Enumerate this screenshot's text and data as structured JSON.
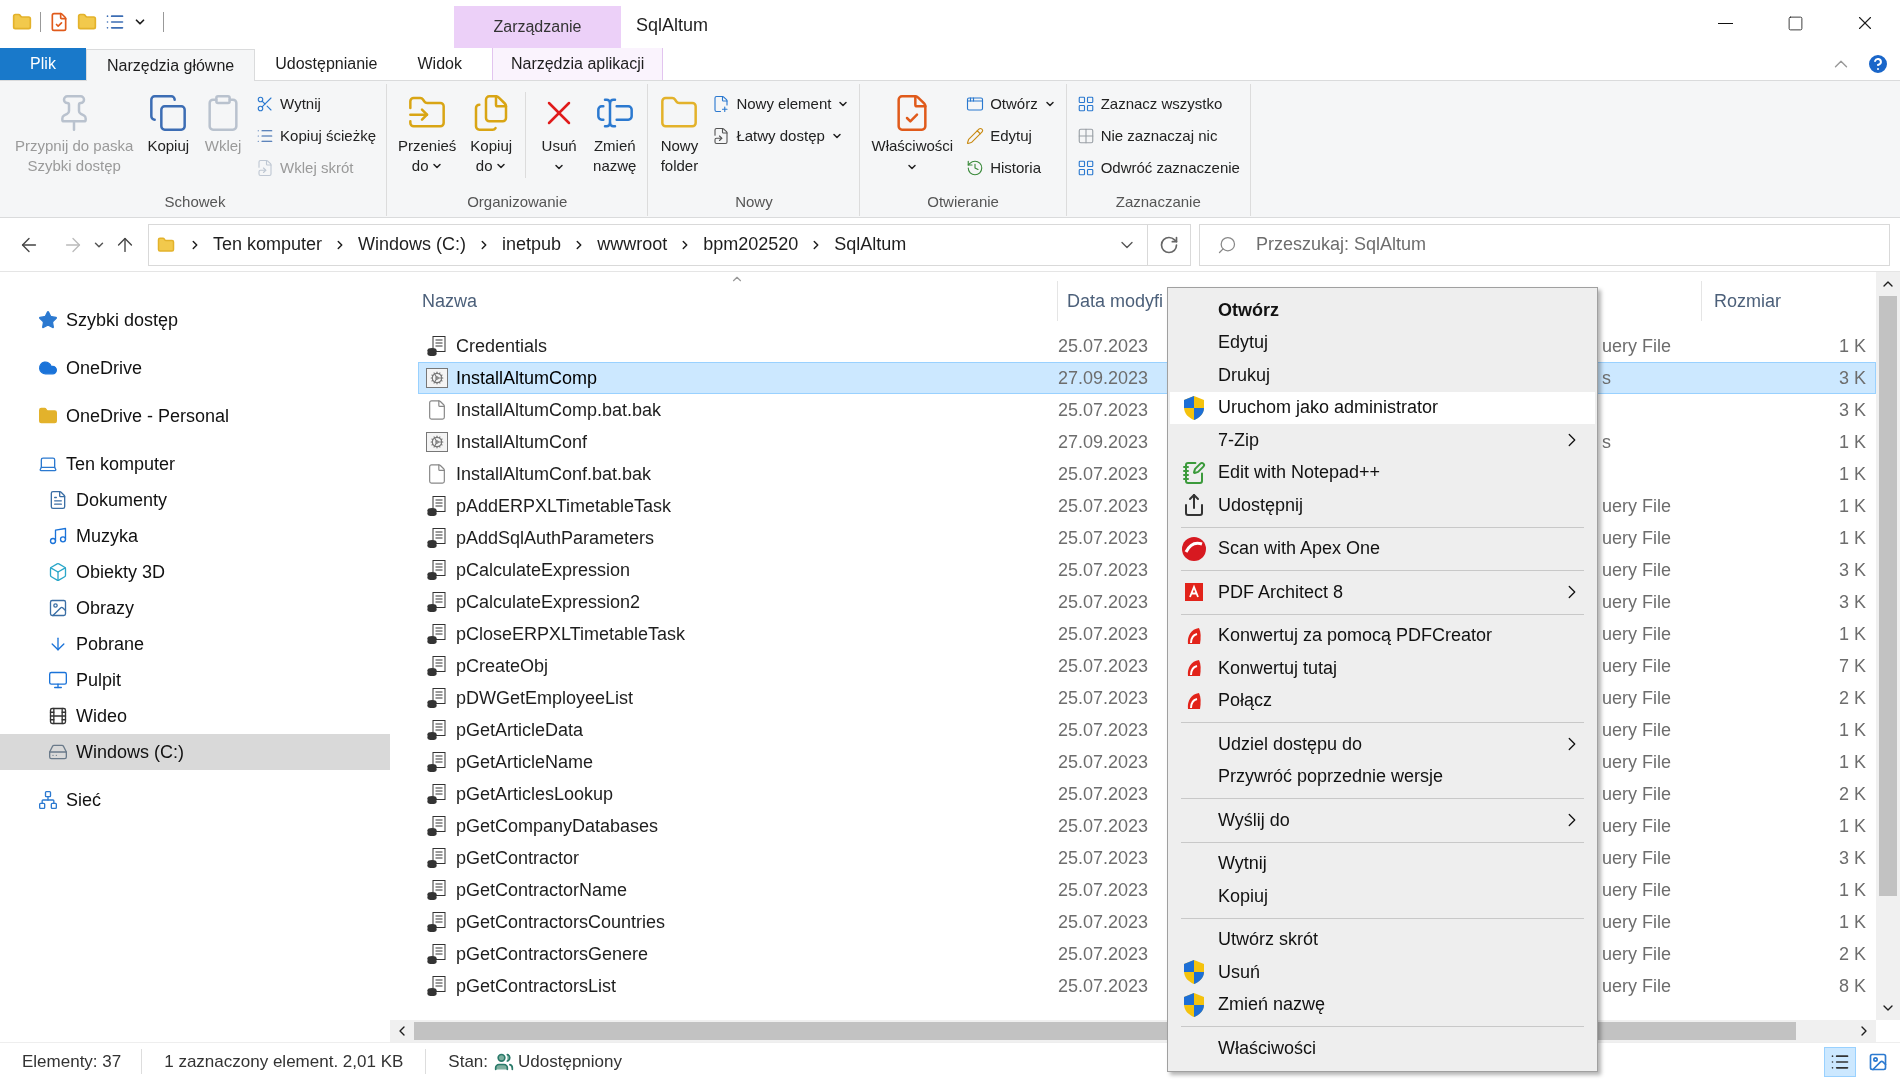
{
  "window": {
    "title": "SqlAltum",
    "contextual_group": "Zarządzanie"
  },
  "ribbon_tabs": [
    {
      "label": "Plik",
      "kind": "file",
      "selected": false
    },
    {
      "label": "Narzędzia główne",
      "kind": "tab",
      "selected": true
    },
    {
      "label": "Udostępnianie",
      "kind": "tab",
      "selected": false
    },
    {
      "label": "Widok",
      "kind": "tab",
      "selected": false
    },
    {
      "label": "Narzędzia aplikacji",
      "kind": "contextual",
      "selected": false
    }
  ],
  "ribbon_groups": [
    {
      "label": "Schowek",
      "items": [
        {
          "kind": "large",
          "lines": [
            "Przypnij do paska",
            "Szybki dostęp"
          ],
          "disabled": true,
          "dropdown": false
        },
        {
          "kind": "large",
          "lines": [
            "Kopiuj"
          ],
          "disabled": false,
          "dropdown": false
        },
        {
          "kind": "large",
          "lines": [
            "Wklej"
          ],
          "disabled": true,
          "dropdown": false
        },
        {
          "kind": "small",
          "lines": [
            "Wytnij"
          ],
          "disabled": false,
          "dropdown": false
        },
        {
          "kind": "small",
          "lines": [
            "Kopiuj ścieżkę"
          ],
          "disabled": false,
          "dropdown": false
        },
        {
          "kind": "small",
          "lines": [
            "Wklej skrót"
          ],
          "disabled": true,
          "dropdown": false
        }
      ]
    },
    {
      "label": "Organizowanie",
      "items": [
        {
          "kind": "large",
          "lines": [
            "Przenieś",
            "do"
          ],
          "disabled": false,
          "dropdown": true
        },
        {
          "kind": "large",
          "lines": [
            "Kopiuj",
            "do"
          ],
          "disabled": false,
          "dropdown": true
        },
        {
          "kind": "divider"
        },
        {
          "kind": "large",
          "lines": [
            "Usuń"
          ],
          "disabled": false,
          "dropdown": true
        },
        {
          "kind": "large",
          "lines": [
            "Zmień",
            "nazwę"
          ],
          "disabled": false,
          "dropdown": false
        }
      ]
    },
    {
      "label": "Nowy",
      "items": [
        {
          "kind": "large",
          "lines": [
            "Nowy",
            "folder"
          ],
          "disabled": false,
          "dropdown": false
        },
        {
          "kind": "small",
          "lines": [
            "Nowy element"
          ],
          "disabled": false,
          "dropdown": true
        },
        {
          "kind": "small",
          "lines": [
            "Łatwy dostęp"
          ],
          "disabled": false,
          "dropdown": true
        }
      ]
    },
    {
      "label": "Otwieranie",
      "items": [
        {
          "kind": "large",
          "lines": [
            "Właściwości"
          ],
          "disabled": false,
          "dropdown": true
        },
        {
          "kind": "small",
          "lines": [
            "Otwórz"
          ],
          "disabled": false,
          "dropdown": true
        },
        {
          "kind": "small",
          "lines": [
            "Edytuj"
          ],
          "disabled": false,
          "dropdown": false
        },
        {
          "kind": "small",
          "lines": [
            "Historia"
          ],
          "disabled": false,
          "dropdown": false
        }
      ]
    },
    {
      "label": "Zaznaczanie",
      "items": [
        {
          "kind": "small",
          "lines": [
            "Zaznacz wszystko"
          ],
          "disabled": false,
          "dropdown": false
        },
        {
          "kind": "small",
          "lines": [
            "Nie zaznaczaj nic"
          ],
          "disabled": false,
          "dropdown": false
        },
        {
          "kind": "small",
          "lines": [
            "Odwróć zaznaczenie"
          ],
          "disabled": false,
          "dropdown": false
        }
      ]
    }
  ],
  "address_bar": {
    "crumbs": [
      "Ten komputer",
      "Windows (C:)",
      "inetpub",
      "wwwroot",
      "bpm202520",
      "SqlAltum"
    ]
  },
  "search": {
    "placeholder": "Przeszukaj: SqlAltum"
  },
  "nav_pane": [
    {
      "label": "Szybki dostęp",
      "selected": false
    },
    {
      "label": "OneDrive",
      "selected": false
    },
    {
      "label": "OneDrive - Personal",
      "selected": false
    },
    {
      "label": "Ten komputer",
      "selected": false,
      "children": [
        {
          "label": "Dokumenty",
          "selected": false
        },
        {
          "label": "Muzyka",
          "selected": false
        },
        {
          "label": "Obiekty 3D",
          "selected": false
        },
        {
          "label": "Obrazy",
          "selected": false
        },
        {
          "label": "Pobrane",
          "selected": false
        },
        {
          "label": "Pulpit",
          "selected": false
        },
        {
          "label": "Wideo",
          "selected": false
        },
        {
          "label": "Windows (C:)",
          "selected": true
        }
      ]
    },
    {
      "label": "Sieć",
      "selected": false
    }
  ],
  "file_list": {
    "columns": [
      "Nazwa",
      "Data modyfi",
      "Rozmiar"
    ],
    "rows": [
      {
        "name": "Credentials",
        "kind": "sql",
        "date": "25.07.2023",
        "type": "uery File",
        "size": "1 K",
        "selected": false
      },
      {
        "name": "InstallAltumComp",
        "kind": "batch",
        "date": "27.09.2023",
        "type": "s",
        "size": "3 K",
        "selected": true
      },
      {
        "name": "InstallAltumComp.bat.bak",
        "kind": "bak",
        "date": "25.07.2023",
        "size": "3 K",
        "selected": false
      },
      {
        "name": "InstallAltumConf",
        "kind": "batch",
        "date": "27.09.2023",
        "type": "s",
        "size": "1 K",
        "selected": false
      },
      {
        "name": "InstallAltumConf.bat.bak",
        "kind": "bak",
        "date": "25.07.2023",
        "size": "1 K",
        "selected": false
      },
      {
        "name": "pAddERPXLTimetableTask",
        "kind": "sql",
        "date": "25.07.2023",
        "type": "uery File",
        "size": "1 K",
        "selected": false
      },
      {
        "name": "pAddSqlAuthParameters",
        "kind": "sql",
        "date": "25.07.2023",
        "type": "uery File",
        "size": "1 K",
        "selected": false
      },
      {
        "name": "pCalculateExpression",
        "kind": "sql",
        "date": "25.07.2023",
        "type": "uery File",
        "size": "3 K",
        "selected": false
      },
      {
        "name": "pCalculateExpression2",
        "kind": "sql",
        "date": "25.07.2023",
        "type": "uery File",
        "size": "3 K",
        "selected": false
      },
      {
        "name": "pCloseERPXLTimetableTask",
        "kind": "sql",
        "date": "25.07.2023",
        "type": "uery File",
        "size": "1 K",
        "selected": false
      },
      {
        "name": "pCreateObj",
        "kind": "sql",
        "date": "25.07.2023",
        "type": "uery File",
        "size": "7 K",
        "selected": false
      },
      {
        "name": "pDWGetEmployeeList",
        "kind": "sql",
        "date": "25.07.2023",
        "type": "uery File",
        "size": "2 K",
        "selected": false
      },
      {
        "name": "pGetArticleData",
        "kind": "sql",
        "date": "25.07.2023",
        "type": "uery File",
        "size": "1 K",
        "selected": false
      },
      {
        "name": "pGetArticleName",
        "kind": "sql",
        "date": "25.07.2023",
        "type": "uery File",
        "size": "1 K",
        "selected": false
      },
      {
        "name": "pGetArticlesLookup",
        "kind": "sql",
        "date": "25.07.2023",
        "type": "uery File",
        "size": "2 K",
        "selected": false
      },
      {
        "name": "pGetCompanyDatabases",
        "kind": "sql",
        "date": "25.07.2023",
        "type": "uery File",
        "size": "1 K",
        "selected": false
      },
      {
        "name": "pGetContractor",
        "kind": "sql",
        "date": "25.07.2023",
        "type": "uery File",
        "size": "3 K",
        "selected": false
      },
      {
        "name": "pGetContractorName",
        "kind": "sql",
        "date": "25.07.2023",
        "type": "uery File",
        "size": "1 K",
        "selected": false
      },
      {
        "name": "pGetContractorsCountries",
        "kind": "sql",
        "date": "25.07.2023",
        "type": "uery File",
        "size": "1 K",
        "selected": false
      },
      {
        "name": "pGetContractorsGenere",
        "kind": "sql",
        "date": "25.07.2023",
        "type": "uery File",
        "size": "2 K",
        "selected": false
      },
      {
        "name": "pGetContractorsList",
        "kind": "sql",
        "date": "25.07.2023",
        "type": "uery File",
        "size": "8 K",
        "selected": false
      }
    ]
  },
  "context_menu": [
    [
      {
        "label": "Otwórz",
        "default": true,
        "highlighted": false,
        "submenu": false
      },
      {
        "label": "Edytuj",
        "default": false,
        "highlighted": false,
        "submenu": false
      },
      {
        "label": "Drukuj",
        "default": false,
        "highlighted": false,
        "submenu": false
      },
      {
        "label": "Uruchom jako administrator",
        "default": false,
        "highlighted": true,
        "submenu": false
      },
      {
        "label": "7-Zip",
        "default": false,
        "highlighted": false,
        "submenu": true
      },
      {
        "label": "Edit with Notepad++",
        "default": false,
        "highlighted": false,
        "submenu": false
      },
      {
        "label": "Udostępnij",
        "default": false,
        "highlighted": false,
        "submenu": false
      }
    ],
    [
      {
        "label": "Scan with Apex One",
        "default": false,
        "highlighted": false,
        "submenu": false
      }
    ],
    [
      {
        "label": "PDF Architect 8",
        "default": false,
        "highlighted": false,
        "submenu": true
      }
    ],
    [
      {
        "label": "Konwertuj za pomocą PDFCreator",
        "default": false,
        "highlighted": false,
        "submenu": false
      },
      {
        "label": "Konwertuj tutaj",
        "default": false,
        "highlighted": false,
        "submenu": false
      },
      {
        "label": "Połącz",
        "default": false,
        "highlighted": false,
        "submenu": false
      }
    ],
    [
      {
        "label": "Udziel dostępu do",
        "default": false,
        "highlighted": false,
        "submenu": true
      },
      {
        "label": "Przywróć poprzednie wersje",
        "default": false,
        "highlighted": false,
        "submenu": false
      }
    ],
    [
      {
        "label": "Wyślij do",
        "default": false,
        "highlighted": false,
        "submenu": true
      }
    ],
    [
      {
        "label": "Wytnij",
        "default": false,
        "highlighted": false,
        "submenu": false
      },
      {
        "label": "Kopiuj",
        "default": false,
        "highlighted": false,
        "submenu": false
      }
    ],
    [
      {
        "label": "Utwórz skrót",
        "default": false,
        "highlighted": false,
        "submenu": false
      },
      {
        "label": "Usuń",
        "default": false,
        "highlighted": false,
        "submenu": false
      },
      {
        "label": "Zmień nazwę",
        "default": false,
        "highlighted": false,
        "submenu": false
      }
    ],
    [
      {
        "label": "Właściwości",
        "default": false,
        "highlighted": false,
        "submenu": false
      }
    ]
  ],
  "status_bar": {
    "items": "Elementy: 37",
    "selection": "1 zaznaczony element. 2,01 KB",
    "state_label": "Stan:",
    "state_value": "Udostępniony",
    "views": [
      {
        "kind": "details",
        "selected": true
      },
      {
        "kind": "thumbnails",
        "selected": false
      }
    ]
  }
}
